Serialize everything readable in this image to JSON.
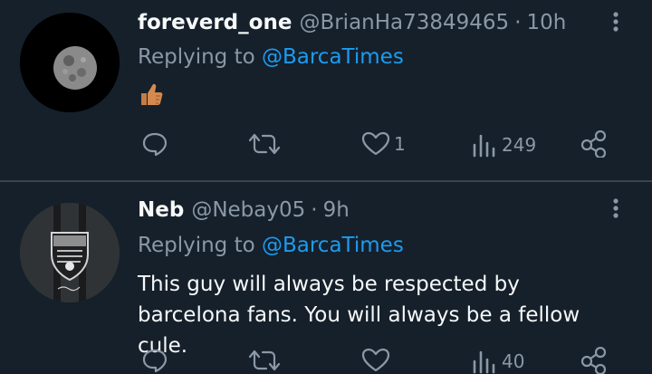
{
  "tweets": [
    {
      "display_name": "foreverd_one",
      "handle": "@BrianHa73849465",
      "separator": "·",
      "time": "10h",
      "replying_prefix": "Replying to",
      "replying_to": "@BarcaTimes",
      "body_emoji": "thumbs-up-icon",
      "actions": {
        "reply": "",
        "retweet": "",
        "like": "1",
        "views": "249"
      }
    },
    {
      "display_name": "Neb",
      "handle": "@Nebay05",
      "separator": "·",
      "time": "9h",
      "replying_prefix": "Replying to",
      "replying_to": "@BarcaTimes",
      "body": "This guy will always be respected by barcelona fans. You will always be a fellow cule.",
      "actions": {
        "reply": "",
        "retweet": "",
        "like": "",
        "views": "40"
      }
    }
  ],
  "colors": {
    "background": "#15202b",
    "divider": "#38444d",
    "primary_text": "#f7f9f9",
    "secondary_text": "#8b98a5",
    "link": "#1d9bf0"
  }
}
